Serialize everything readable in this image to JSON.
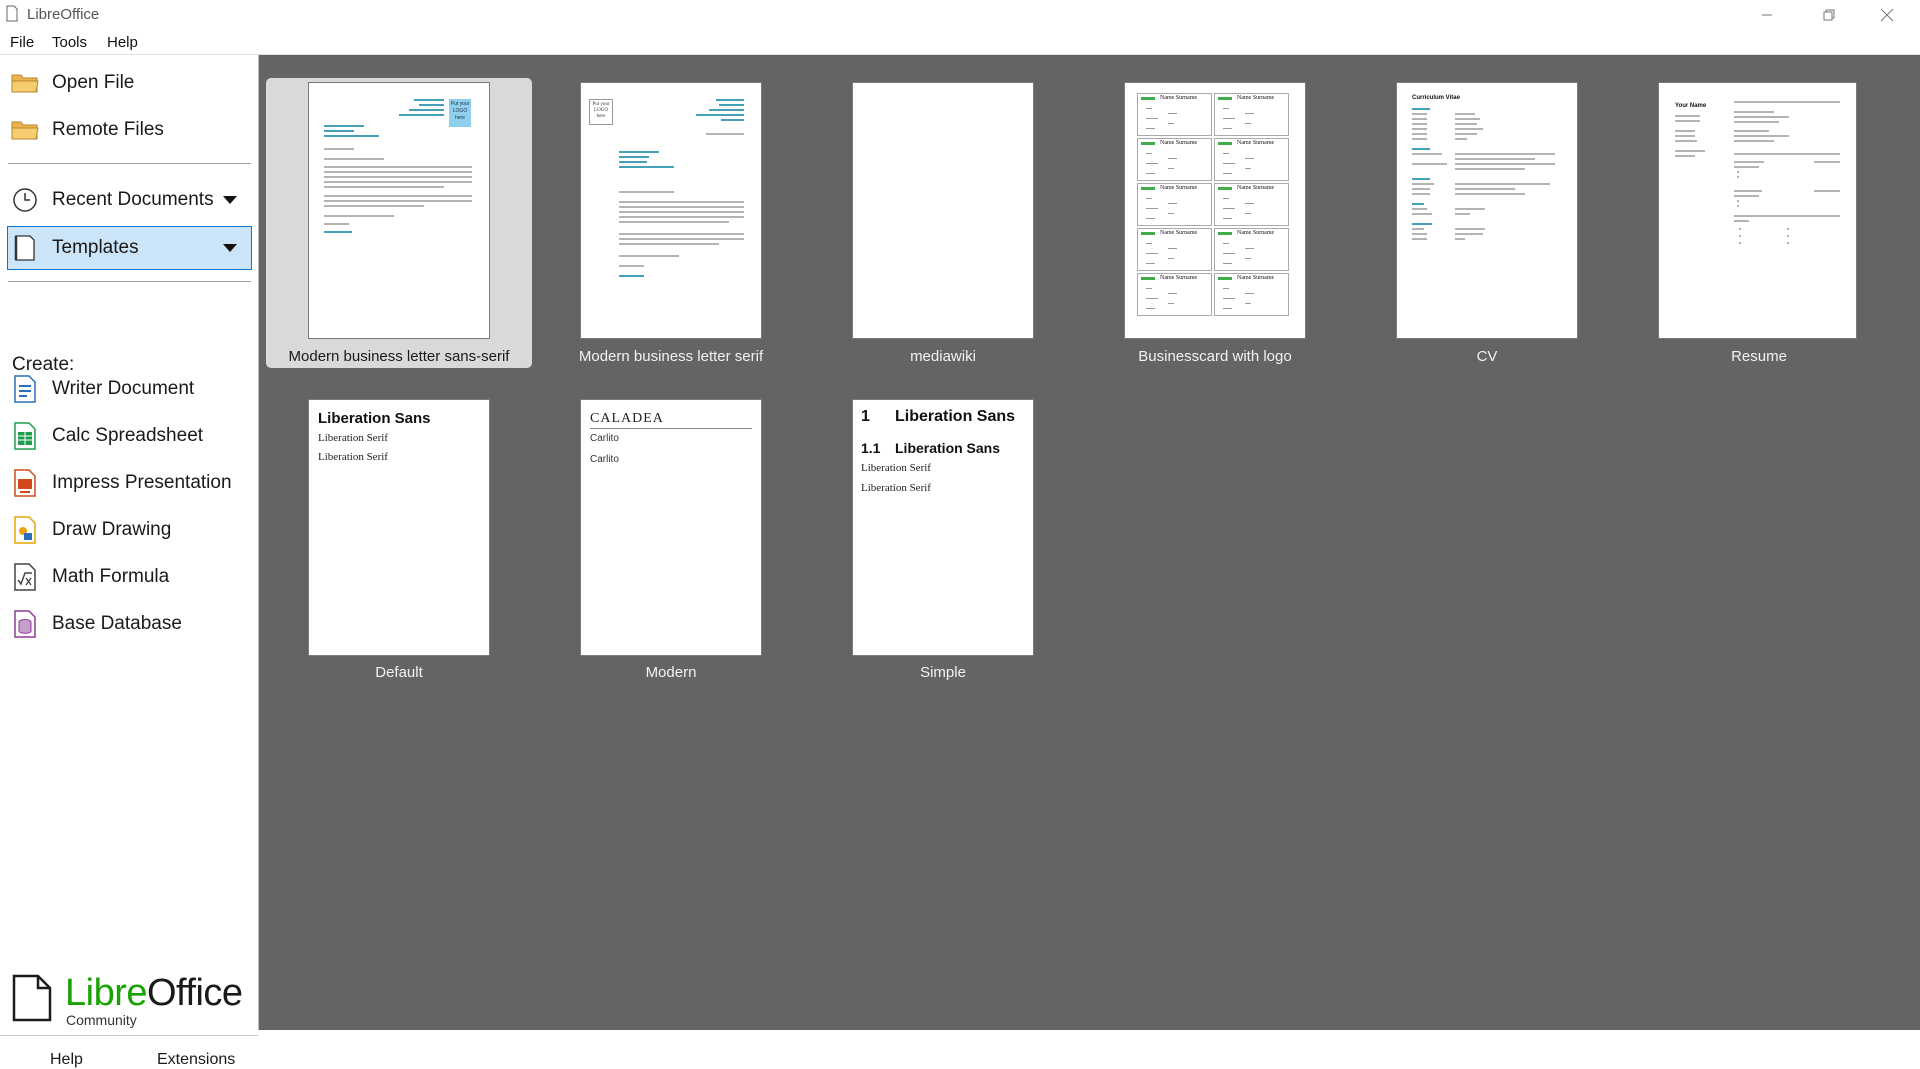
{
  "window": {
    "title": "LibreOffice",
    "controls": [
      "minimize-icon",
      "restore-icon",
      "close-icon"
    ]
  },
  "menubar": {
    "items": [
      {
        "label": "File"
      },
      {
        "label": "Tools"
      },
      {
        "label": "Help"
      }
    ]
  },
  "sidebar": {
    "open_file": "Open File",
    "remote_files": "Remote Files",
    "recent_documents": "Recent Documents",
    "templates": "Templates",
    "create_label": "Create:",
    "create_items": [
      {
        "label": "Writer Document",
        "icon": "writer-icon",
        "color": "#2a6ebb"
      },
      {
        "label": "Calc Spreadsheet",
        "icon": "calc-icon",
        "color": "#1e9e4a"
      },
      {
        "label": "Impress Presentation",
        "icon": "impress-icon",
        "color": "#d0481c"
      },
      {
        "label": "Draw Drawing",
        "icon": "draw-icon",
        "color": "#e5a50a"
      },
      {
        "label": "Math Formula",
        "icon": "math-icon",
        "color": "#444444"
      },
      {
        "label": "Base Database",
        "icon": "base-icon",
        "color": "#8e3c96"
      }
    ],
    "logo": {
      "libre": "Libre",
      "office": "Office",
      "community": "Community"
    },
    "bottom": {
      "help": "Help",
      "extensions": "Extensions"
    }
  },
  "templates": [
    {
      "name": "Modern business letter sans-serif",
      "selected": true
    },
    {
      "name": "Modern business letter serif",
      "selected": false
    },
    {
      "name": "mediawiki",
      "selected": false
    },
    {
      "name": "Businesscard with logo",
      "selected": false
    },
    {
      "name": "CV",
      "selected": false
    },
    {
      "name": "Resume",
      "selected": false
    },
    {
      "name": "Default",
      "selected": false
    },
    {
      "name": "Modern",
      "selected": false
    },
    {
      "name": "Simple",
      "selected": false
    }
  ],
  "previews": {
    "letter_logo": "Put your LOGO here",
    "business_card_name": "Name Surname",
    "cv_heading": "Curriculum Vitae",
    "resume_heading": "Your Name",
    "default": {
      "heading": "Liberation Sans",
      "line1": "Liberation Serif",
      "line2": "Liberation Serif"
    },
    "modern": {
      "heading": "CALADEA",
      "line1": "Carlito",
      "line2": "Carlito"
    },
    "simple": {
      "h1_num": "1",
      "h1": "Liberation Sans",
      "h2_num": "1.1",
      "h2": "Liberation Sans",
      "line1": "Liberation Serif",
      "line2": "Liberation Serif"
    }
  },
  "colors": {
    "accent": "#0078d7",
    "selection": "#cce4f7",
    "panel_bg": "#646464",
    "libre_green": "#18a303"
  }
}
